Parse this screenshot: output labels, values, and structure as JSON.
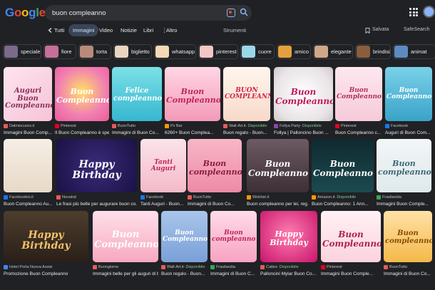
{
  "logo": "Google",
  "search": {
    "query": "buon compleanno"
  },
  "tabs": [
    {
      "label": "Tutti"
    },
    {
      "label": "Immagini"
    },
    {
      "label": "Video"
    },
    {
      "label": "Notizie"
    },
    {
      "label": "Libri"
    },
    {
      "label": "Altro"
    }
  ],
  "tools_label": "Strumenti",
  "saved_label": "Salvata",
  "safesearch_label": "SafeSearch",
  "chips": [
    {
      "label": "speciale",
      "color": "#7a6a8c"
    },
    {
      "label": "fiore",
      "color": "#c66f9a"
    },
    {
      "label": "torta",
      "color": "#b98a7a"
    },
    {
      "label": "biglietto",
      "color": "#e9d5c0"
    },
    {
      "label": "whatsapp",
      "color": "#f3d9b6"
    },
    {
      "label": "pinterest",
      "color": "#f2c7c5"
    },
    {
      "label": "cuore",
      "color": "#9ad7e8"
    },
    {
      "label": "amico",
      "color": "#e4a03d"
    },
    {
      "label": "elegante",
      "color": "#cfa88a"
    },
    {
      "label": "brindisi",
      "color": "#8a5e3c"
    },
    {
      "label": "animat",
      "color": "#5e8ac2"
    }
  ],
  "images": [
    {
      "source": "Dalmiocuore.it",
      "title": "Immagini Buon Comp...",
      "fav": "#e25c5c",
      "avail": "",
      "bg": "linear-gradient(135deg,#fde4ee,#f6c4d6)",
      "overlay": "Auguri Buon Compleanno",
      "ovcolor": "#8c2e5a"
    },
    {
      "source": "Pinterest",
      "title": "Il Buon Compleanno è speciale",
      "fav": "#e60023",
      "avail": "",
      "bg": "radial-gradient(circle at 50% 45%,#ffe066,#f17fb1 60%,#e95c9a)",
      "overlay": "Buon Compleanno",
      "ovcolor": "#ffffff"
    },
    {
      "source": "BuonTutto",
      "title": "Immagini di Buon Co...",
      "fav": "#e25c5c",
      "avail": "",
      "bg": "linear-gradient(180deg,#7ce0e6,#36b7d0)",
      "overlay": "Felice compleanno",
      "ovcolor": "#ffffff"
    },
    {
      "source": "Px Bar",
      "title": "6260+ Buon Complea...",
      "fav": "#f29900",
      "avail": "",
      "bg": "linear-gradient(180deg,#ffd6e4,#f39ab8)",
      "overlay": "Buon Compleanno",
      "ovcolor": "#c0265a"
    },
    {
      "source": "Wall-Art.it",
      "title": "Buon regalo - Buon...",
      "fav": "#e25c5c",
      "avail": "Disponibile",
      "bg": "linear-gradient(180deg,#fff6ee,#f7d9c9)",
      "overlay": "BUON COMPLEANNO",
      "ovcolor": "#d1234b"
    },
    {
      "source": "Follya Party",
      "title": "Follya | Palloncino Buon ...",
      "fav": "#8e44ad",
      "avail": "Disponibile",
      "bg": "radial-gradient(circle at 50% 50%,#ffffff,#e9e4e6 70%,#cfc7cb)",
      "overlay": "Buon Compleanno",
      "ovcolor": "#c2185b"
    },
    {
      "source": "Pinterest",
      "title": "Buon Compleanno c...",
      "fav": "#e60023",
      "avail": "",
      "bg": "linear-gradient(180deg,#fde7ef,#f6cad9)",
      "overlay": "Buon Compleanno",
      "ovcolor": "#b03060"
    },
    {
      "source": "Facebook",
      "title": "Auguri di Buon Com...",
      "fav": "#1877f2",
      "avail": "",
      "bg": "linear-gradient(180deg,#7ad1e8,#3aa3c9)",
      "overlay": "Buon Compleanno",
      "ovcolor": "#ffffff"
    },
    {
      "source": "Facebookini.it",
      "title": "Buon Compleanno Au...",
      "fav": "#1877f2",
      "avail": "",
      "bg": "linear-gradient(180deg,#f6efe6,#e7d9c7)",
      "overlay": "",
      "ovcolor": "#7a4a2a"
    },
    {
      "source": "Novakid",
      "title": "Le frasi più belle per augurare buon co...",
      "fav": "#e25c5c",
      "avail": "",
      "bg": "radial-gradient(circle at 50% 50%,#3b2a7a,#1a1245)",
      "overlay": "Happy Birthday",
      "ovcolor": "#ffffff"
    },
    {
      "source": "Facebook",
      "title": "Tanti Auguri - Buon...",
      "fav": "#1877f2",
      "avail": "",
      "bg": "linear-gradient(180deg,#fbe3ea,#f4b9c9)",
      "overlay": "Tanti Auguri",
      "ovcolor": "#c0265a"
    },
    {
      "source": "BuonTutto",
      "title": "Immagini di Buon Co...",
      "fav": "#e25c5c",
      "avail": "",
      "bg": "linear-gradient(180deg,#f8b6c7,#ee8aa5)",
      "overlay": "Buon compleanno",
      "ovcolor": "#8a1d42"
    },
    {
      "source": "Wishlist.it",
      "title": "Buon compleanno per lei, reg...",
      "fav": "#f29900",
      "avail": "",
      "bg": "linear-gradient(180deg,#6d5a63,#3d2f35)",
      "overlay": "Buon Compleanno",
      "ovcolor": "#ffffff"
    },
    {
      "source": "Amazon.it",
      "title": "Buon Compleanno: 1 Ann...",
      "fav": "#ff9900",
      "avail": "Disponibile",
      "bg": "linear-gradient(180deg,#0f2a2e,#1c4a50)",
      "overlay": "Buon Compleanno",
      "ovcolor": "#ffffff"
    },
    {
      "source": "Frasilandia",
      "title": "Immagini Buon Comple...",
      "fav": "#34a853",
      "avail": "",
      "bg": "linear-gradient(180deg,#f2f6f7,#dfe9ec)",
      "overlay": "Buon compleanno",
      "ovcolor": "#3d6b75"
    },
    {
      "source": "Hotel Porta Nuova Assisi",
      "title": "Promozione Buon Compleanno",
      "fav": "#4285f4",
      "avail": "",
      "bg": "linear-gradient(180deg,#4d3d2d,#2a2018)",
      "overlay": "Happy Birthday",
      "ovcolor": "#f3c26b"
    },
    {
      "source": "Buongiorno",
      "title": "Immagini belle per gli auguri di b...",
      "fav": "#e25c5c",
      "avail": "",
      "bg": "linear-gradient(180deg,#ffe0ea,#f7a8c0)",
      "overlay": "Buon Compleanno",
      "ovcolor": "#ffffff"
    },
    {
      "source": "Wall-Art.it",
      "title": "Buon regalo - Buon...",
      "fav": "#e25c5c",
      "avail": "Disponibile",
      "bg": "linear-gradient(180deg,#a9c5ea,#7aa0d8)",
      "overlay": "Buon Compleanno",
      "ovcolor": "#ffffff"
    },
    {
      "source": "Frasilandia",
      "title": "Immagini di Buon C...",
      "fav": "#34a853",
      "avail": "",
      "bg": "linear-gradient(180deg,#ffdbe8,#f7a3c2)",
      "overlay": "Buon compleanno",
      "ovcolor": "#c0265a"
    },
    {
      "source": "Cattex",
      "title": "Palloncini Mylar Buon Co...",
      "fav": "#e25c5c",
      "avail": "Disponibile",
      "bg": "radial-gradient(circle at 50% 45%,#ff7eb1,#c8146a)",
      "overlay": "Happy Birthday",
      "ovcolor": "#ffffff"
    },
    {
      "source": "Pinterest",
      "title": "Immagini Buon Comple...",
      "fav": "#e60023",
      "avail": "",
      "bg": "linear-gradient(180deg,#fff1f4,#fbd3df)",
      "overlay": "Buon Compleanno!",
      "ovcolor": "#b0224e"
    },
    {
      "source": "BuonTutto",
      "title": "Immagini di Buon Co...",
      "fav": "#e25c5c",
      "avail": "",
      "bg": "linear-gradient(180deg,#ffe1a8,#f4b949)",
      "overlay": "Buon compleanno",
      "ovcolor": "#8a4a00"
    }
  ]
}
